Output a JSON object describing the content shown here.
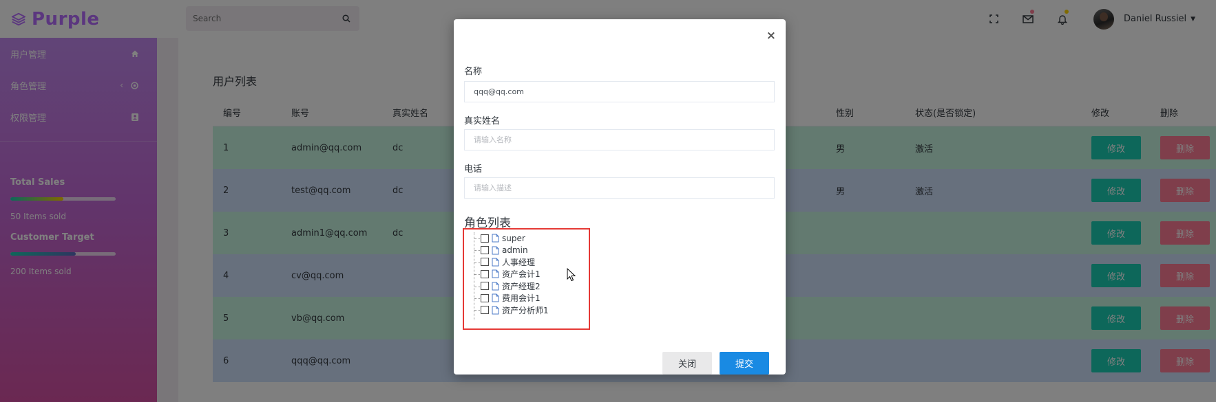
{
  "brand": {
    "name": "Purple",
    "color": "#b66dff"
  },
  "search": {
    "placeholder": "Search"
  },
  "topnav": {
    "icons": [
      "fullscreen-icon",
      "mail-icon",
      "bell-icon"
    ],
    "mail_dot_color": "#fe7c96",
    "bell_dot_color": "#ffd500",
    "user_name": "Daniel Russiel"
  },
  "sidebar": {
    "items": [
      {
        "label": "用户管理",
        "icon": "home-icon"
      },
      {
        "label": "角色管理",
        "icon": "crosshairs-icon",
        "arrow": "‹"
      },
      {
        "label": "权限管理",
        "icon": "contacts-icon"
      }
    ],
    "stats": [
      {
        "title": "Total Sales",
        "note": "50 Items sold",
        "progress": 0.5,
        "color": "#ffd500"
      },
      {
        "title": "Customer Target",
        "note": "200 Items sold",
        "progress": 0.62,
        "color": "#5c6bc0"
      }
    ]
  },
  "main": {
    "title": "用户列表",
    "columns": [
      "编号",
      "账号",
      "真实姓名",
      "性别",
      "状态(是否锁定)",
      "修改",
      "删除"
    ],
    "rows": [
      {
        "id": "1",
        "account": "admin@qq.com",
        "real_name": "dc",
        "sex": "男",
        "state": "激活"
      },
      {
        "id": "2",
        "account": "test@qq.com",
        "real_name": "dc",
        "sex": "男",
        "state": "激活"
      },
      {
        "id": "3",
        "account": "admin1@qq.com",
        "real_name": "dc",
        "sex": "",
        "state": ""
      },
      {
        "id": "4",
        "account": "cv@qq.com",
        "real_name": "",
        "sex": "",
        "state": ""
      },
      {
        "id": "5",
        "account": "vb@qq.com",
        "real_name": "",
        "sex": "",
        "state": ""
      },
      {
        "id": "6",
        "account": "qqq@qq.com",
        "real_name": "",
        "sex": "",
        "state": ""
      }
    ],
    "edit_label": "修改",
    "delete_label": "删除"
  },
  "modal": {
    "close_symbol": "×",
    "name_label": "名称",
    "name_value": "qqq@qq.com",
    "realname_label": "真实姓名",
    "realname_placeholder": "请输入名称",
    "phone_label": "电话",
    "phone_placeholder": "请输入描述",
    "roles_title": "角色列表",
    "roles": [
      "super",
      "admin",
      "人事经理",
      "资产会计1",
      "资产经理2",
      "费用会计1",
      "资产分析师1"
    ],
    "close_button": "关闭",
    "submit_button": "提交"
  }
}
